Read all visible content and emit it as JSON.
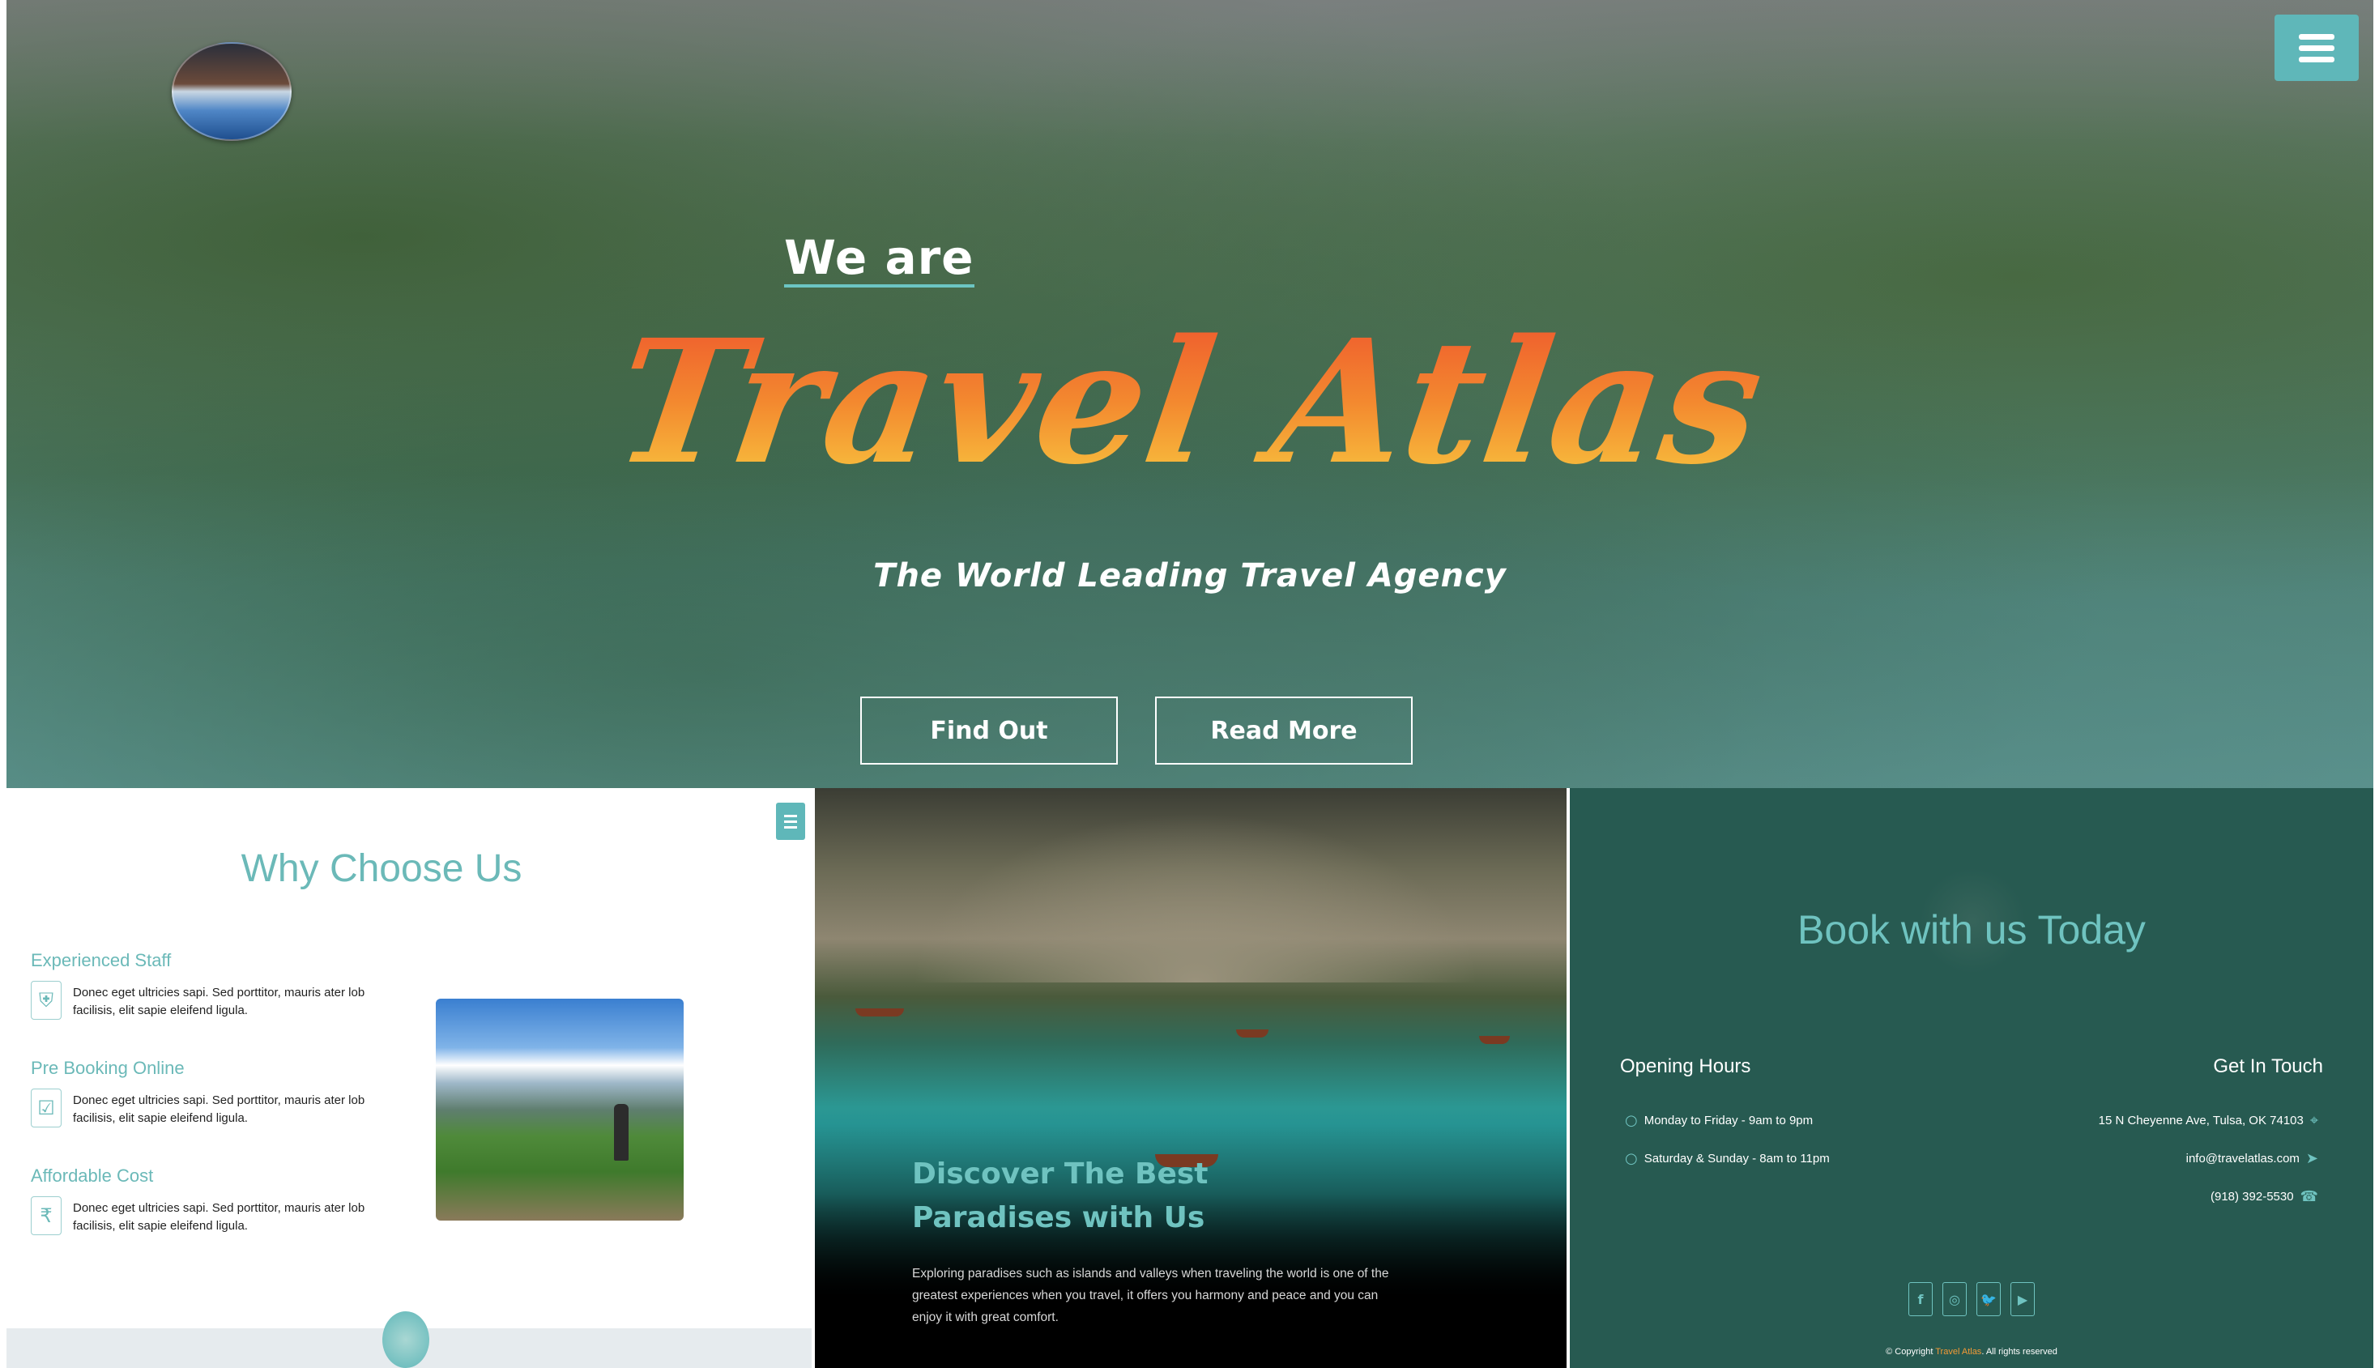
{
  "hero": {
    "we_are": "We are",
    "title": "Travel Atlas",
    "tagline": "The World Leading Travel Agency",
    "buttons": {
      "find_out": "Find Out",
      "read_more": "Read More"
    }
  },
  "why": {
    "title": "Why Choose Us",
    "features": [
      {
        "title": "Experienced Staff",
        "icon": "shield-icon",
        "text": "Donec eget ultricies sapi. Sed porttitor, mauris ater lob facilisis, elit sapie eleifend ligula."
      },
      {
        "title": "Pre Booking Online",
        "icon": "checkbox-icon",
        "text": "Donec eget ultricies sapi. Sed porttitor, mauris ater lob facilisis, elit sapie eleifend ligula."
      },
      {
        "title": "Affordable Cost",
        "icon": "rupee-icon",
        "text": "Donec eget ultricies sapi. Sed porttitor, mauris ater lob facilisis, elit sapie eleifend ligula."
      }
    ]
  },
  "discover": {
    "title": "Discover The Best Paradises with Us",
    "text": "Exploring paradises such as islands and valleys when traveling the world is one of the greatest experiences when you travel, it offers you harmony and peace and you can enjoy it with great comfort."
  },
  "book": {
    "title": "Book with us Today",
    "opening_hours": {
      "title": "Opening Hours",
      "rows": [
        "Monday to Friday - 9am to 9pm",
        "Saturday & Sunday - 8am to 11pm"
      ]
    },
    "get_in_touch": {
      "title": "Get In Touch",
      "address": "15 N Cheyenne Ave, Tulsa, OK 74103",
      "email": "info@travelatlas.com",
      "phone": "(918) 392-5530"
    },
    "social": [
      "facebook-icon",
      "instagram-icon",
      "twitter-icon",
      "youtube-icon"
    ],
    "copyright": {
      "prefix": "© Copyright ",
      "brand": "Travel Atlas",
      "suffix": ". All rights reserved"
    }
  },
  "colors": {
    "accent": "#6fc3c0",
    "menu": "#5fb7b9",
    "dark_panel": "#275a51",
    "title_orange": "#f3892f"
  }
}
